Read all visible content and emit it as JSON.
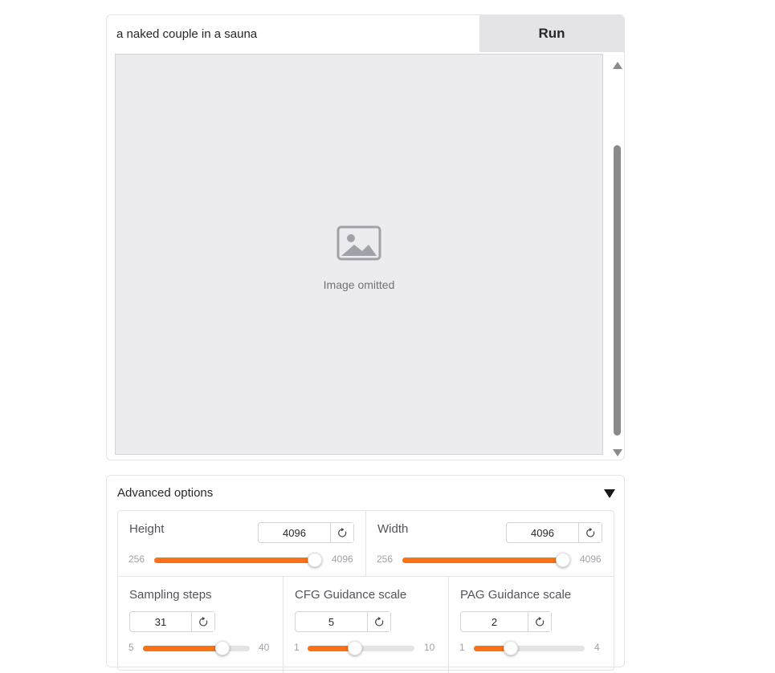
{
  "prompt": {
    "value": "a naked couple in a sauna",
    "placeholder": ""
  },
  "run_button": {
    "label": "Run"
  },
  "image_output": {
    "note": "Image omitted"
  },
  "advanced": {
    "title": "Advanced options",
    "height": {
      "label": "Height",
      "value": "4096",
      "min": "256",
      "max": "4096",
      "fraction": 1.0
    },
    "width": {
      "label": "Width",
      "value": "4096",
      "min": "256",
      "max": "4096",
      "fraction": 1.0
    },
    "sampling_steps": {
      "label": "Sampling steps",
      "value": "31",
      "min": "5",
      "max": "40",
      "fraction": 0.743
    },
    "cfg_scale": {
      "label": "CFG Guidance scale",
      "value": "5",
      "min": "1",
      "max": "10",
      "fraction": 0.444
    },
    "pag_scale": {
      "label": "PAG Guidance scale",
      "value": "2",
      "min": "1",
      "max": "4",
      "fraction": 0.333
    }
  },
  "colors": {
    "accent": "#f97316",
    "track": "#e4e4e7",
    "run_bg": "#e4e4e7"
  },
  "icons": {
    "reset": "reset-icon",
    "collapse": "caret-down-icon",
    "image": "image-icon"
  }
}
